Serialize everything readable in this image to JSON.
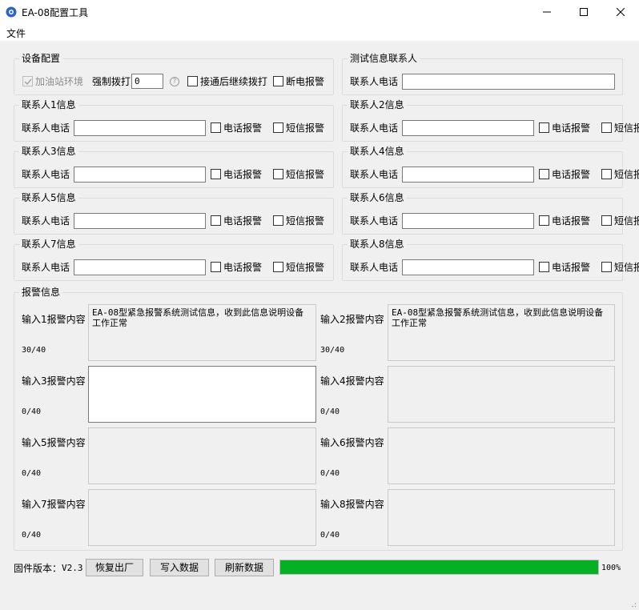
{
  "window": {
    "title": "EA-08配置工具"
  },
  "menu": {
    "file": "文件"
  },
  "device_config": {
    "legend": "设备配置",
    "gas_station_label": "加油站环境",
    "gas_station_checked": true,
    "force_dial_label": "强制拨打",
    "force_dial_value": "0",
    "continue_dial_label": "接通后继续拨打",
    "power_off_alarm_label": "断电报警"
  },
  "test_contact": {
    "legend": "测试信息联系人",
    "phone_label": "联系人电话",
    "phone_value": ""
  },
  "contacts": [
    {
      "legend": "联系人1信息",
      "phone_label": "联系人电话",
      "phone_value": "",
      "call_label": "电话报警",
      "sms_label": "短信报警"
    },
    {
      "legend": "联系人2信息",
      "phone_label": "联系人电话",
      "phone_value": "",
      "call_label": "电话报警",
      "sms_label": "短信报警"
    },
    {
      "legend": "联系人3信息",
      "phone_label": "联系人电话",
      "phone_value": "",
      "call_label": "电话报警",
      "sms_label": "短信报警"
    },
    {
      "legend": "联系人4信息",
      "phone_label": "联系人电话",
      "phone_value": "",
      "call_label": "电话报警",
      "sms_label": "短信报警"
    },
    {
      "legend": "联系人5信息",
      "phone_label": "联系人电话",
      "phone_value": "",
      "call_label": "电话报警",
      "sms_label": "短信报警"
    },
    {
      "legend": "联系人6信息",
      "phone_label": "联系人电话",
      "phone_value": "",
      "call_label": "电话报警",
      "sms_label": "短信报警"
    },
    {
      "legend": "联系人7信息",
      "phone_label": "联系人电话",
      "phone_value": "",
      "call_label": "电话报警",
      "sms_label": "短信报警"
    },
    {
      "legend": "联系人8信息",
      "phone_label": "联系人电话",
      "phone_value": "",
      "call_label": "电话报警",
      "sms_label": "短信报警"
    }
  ],
  "alarm_info": {
    "legend": "报警信息",
    "inputs": [
      {
        "label": "输入1报警内容",
        "text": "EA-08型紧急报警系统测试信息，收到此信息说明设备工作正常",
        "count": "30/40"
      },
      {
        "label": "输入2报警内容",
        "text": "EA-08型紧急报警系统测试信息，收到此信息说明设备工作正常",
        "count": "30/40"
      },
      {
        "label": "输入3报警内容",
        "text": "",
        "count": "0/40"
      },
      {
        "label": "输入4报警内容",
        "text": "",
        "count": "0/40"
      },
      {
        "label": "输入5报警内容",
        "text": "",
        "count": "0/40"
      },
      {
        "label": "输入6报警内容",
        "text": "",
        "count": "0/40"
      },
      {
        "label": "输入7报警内容",
        "text": "",
        "count": "0/40"
      },
      {
        "label": "输入8报警内容",
        "text": "",
        "count": "0/40"
      }
    ]
  },
  "footer": {
    "firmware_label": "固件版本：",
    "firmware_version": "V2.3",
    "restore_button": "恢复出厂",
    "write_button": "写入数据",
    "refresh_button": "刷新数据",
    "progress_percent": 100,
    "progress_text": "100%"
  },
  "colors": {
    "progress": "#06b025",
    "icon_blue": "#2b63c9"
  }
}
